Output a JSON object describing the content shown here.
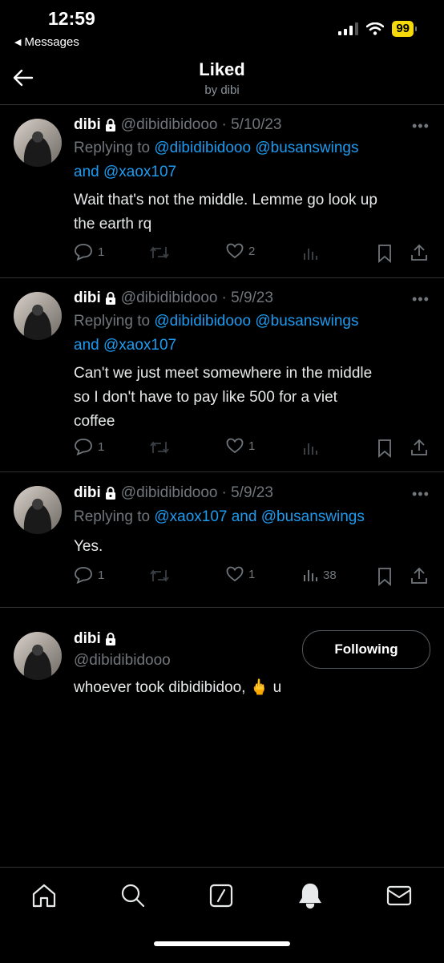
{
  "status_bar": {
    "time": "12:59",
    "back_app": "Messages",
    "battery": "99"
  },
  "header": {
    "title": "Liked",
    "subtitle": "by dibi"
  },
  "tweets": [
    {
      "name": "dibi",
      "handle": "@dibidibidooo",
      "date": "· 5/10/23",
      "replying_prefix": "Replying to ",
      "reply_1": "@dibidibidooo",
      "reply_2": "@busanswings",
      "reply_and": "and ",
      "reply_3": "@xaox107",
      "text_1": "Wait that's not the middle. Lemme go look up",
      "text_2": "the earth rq",
      "replies": "1",
      "likes": "2"
    },
    {
      "name": "dibi",
      "handle": "@dibidibidooo",
      "date": "· 5/9/23",
      "replying_prefix": "Replying to ",
      "reply_1": "@dibidibidooo",
      "reply_2": "@busanswings",
      "reply_and": "and ",
      "reply_3": "@xaox107",
      "text_1": "Can't we just meet somewhere in the middle",
      "text_2": "so I don't have to pay like 500 for a viet",
      "text_3": "coffee",
      "replies": "1",
      "likes": "1"
    },
    {
      "name": "dibi",
      "handle": "@dibidibidooo",
      "date": "· 5/9/23",
      "replying_prefix": "Replying to ",
      "reply_1": "@xaox107 and ",
      "reply_2": "@busanswings",
      "text_1": "Yes.",
      "replies": "1",
      "likes": "1",
      "views": "38"
    }
  ],
  "profile_card": {
    "name": "dibi",
    "handle": "@dibidibidooo",
    "button": "Following",
    "bio": "whoever took dibidibidoo, 🖕 u"
  },
  "colors": {
    "accent": "#1d9bf0",
    "muted": "#71767b",
    "battery": "#f5d90a"
  },
  "tabs": [
    "home-icon",
    "search-icon",
    "grok-icon",
    "notifications-icon",
    "messages-icon"
  ]
}
